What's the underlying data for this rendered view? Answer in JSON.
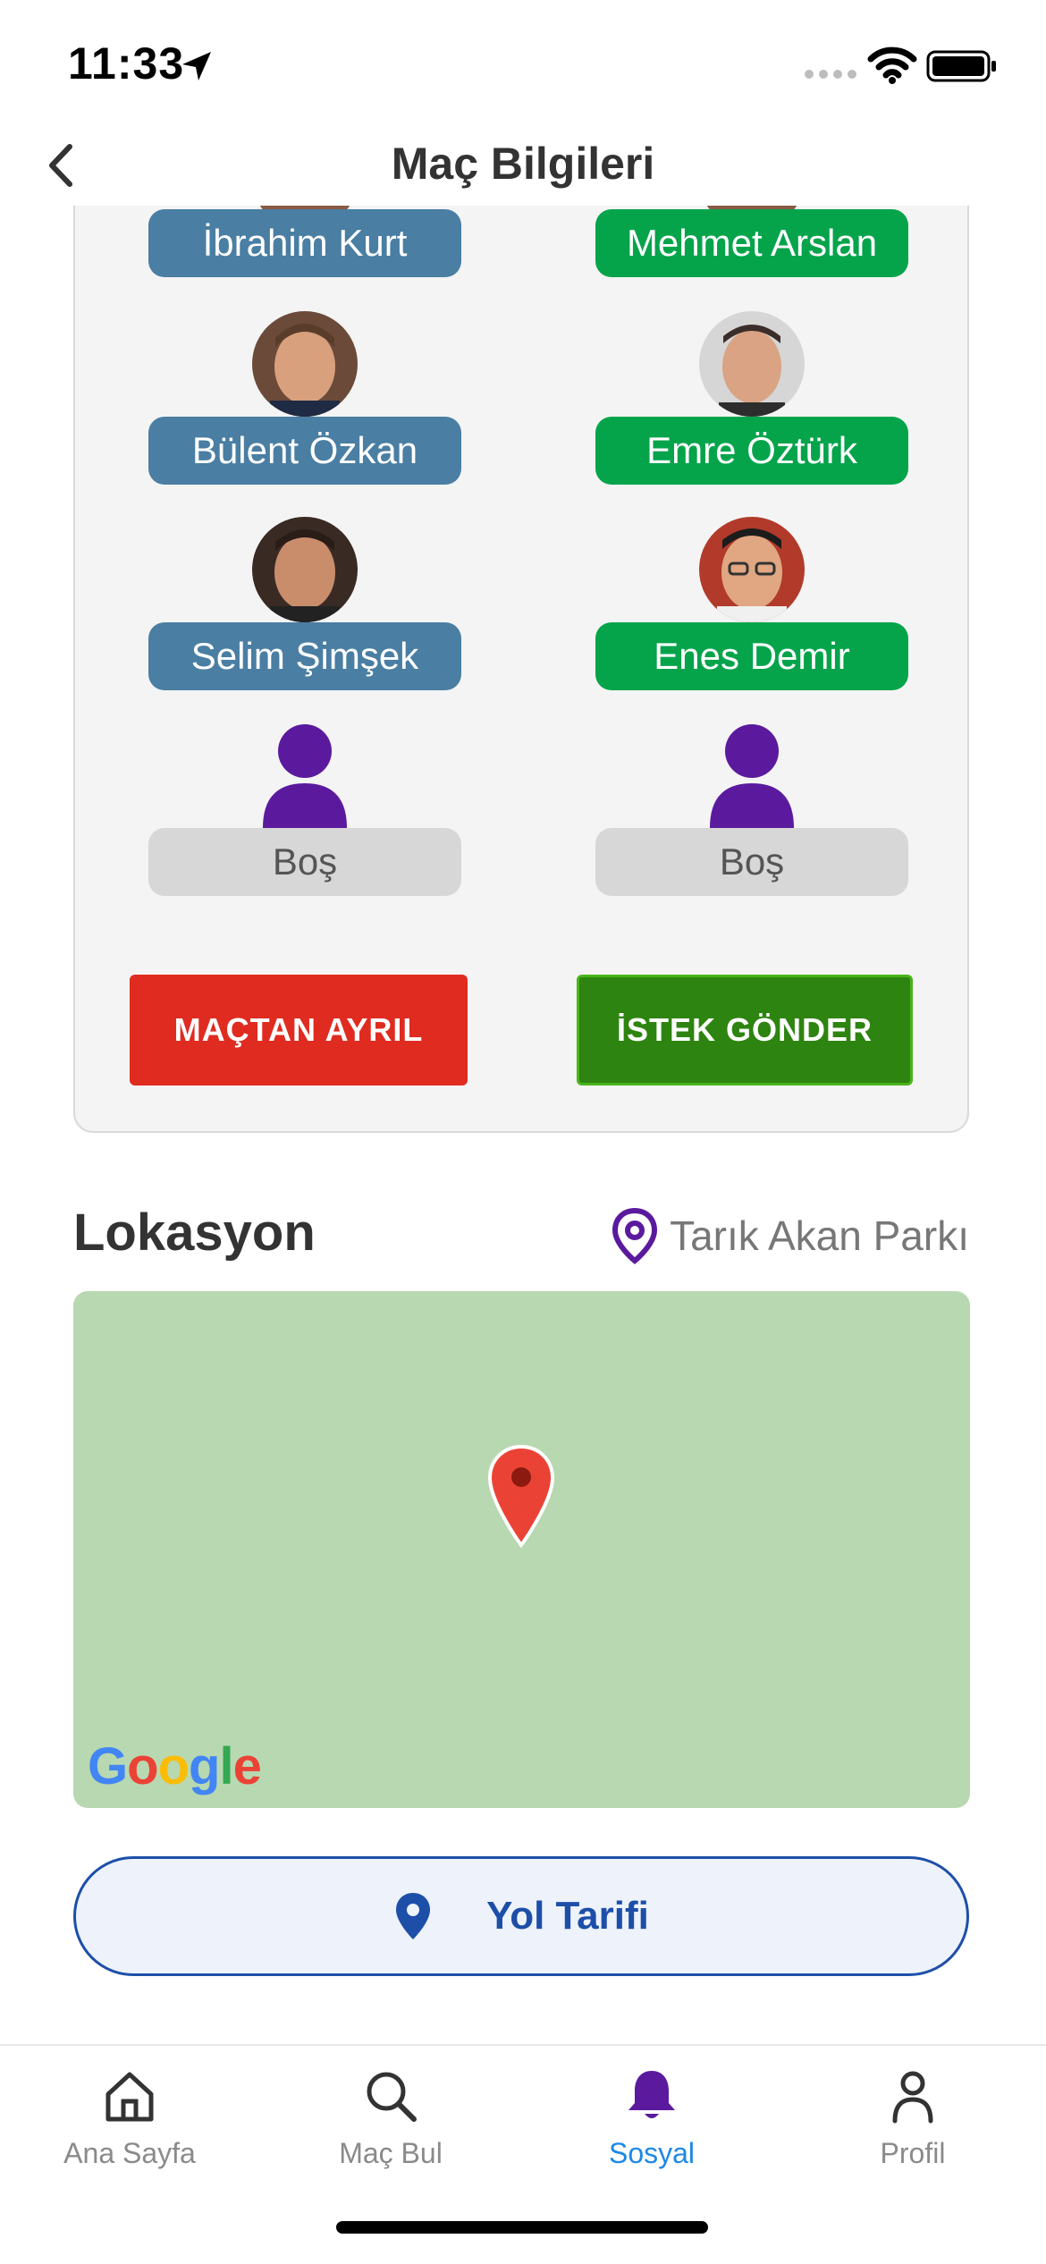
{
  "status_bar": {
    "time": "11:33"
  },
  "header": {
    "title": "Maç Bilgileri"
  },
  "players": {
    "left": [
      {
        "name": "İbrahim Kurt"
      },
      {
        "name": "Bülent Özkan"
      },
      {
        "name": "Selim Şimşek"
      },
      {
        "name": "Boş"
      }
    ],
    "right": [
      {
        "name": "Mehmet Arslan"
      },
      {
        "name": "Emre Öztürk"
      },
      {
        "name": "Enes Demir"
      },
      {
        "name": "Boş"
      }
    ]
  },
  "actions": {
    "leave_label": "MAÇTAN AYRIL",
    "request_label": "İSTEK GÖNDER"
  },
  "location": {
    "title": "Lokasyon",
    "place": "Tarık Akan Parkı",
    "map_brand": "Google",
    "directions_label": "Yol Tarifi"
  },
  "tabs": [
    {
      "label": "Ana Sayfa",
      "icon": "home-icon",
      "active": false
    },
    {
      "label": "Maç Bul",
      "icon": "search-icon",
      "active": false
    },
    {
      "label": "Sosyal",
      "icon": "bell-icon",
      "active": true
    },
    {
      "label": "Profil",
      "icon": "person-icon",
      "active": false
    }
  ],
  "colors": {
    "team_left": "#4a7ea3",
    "team_right": "#05a44b",
    "leave": "#e02b20",
    "request": "#2e8410",
    "accent_purple": "#5b1a9e",
    "active_tab": "#1e88e5"
  }
}
